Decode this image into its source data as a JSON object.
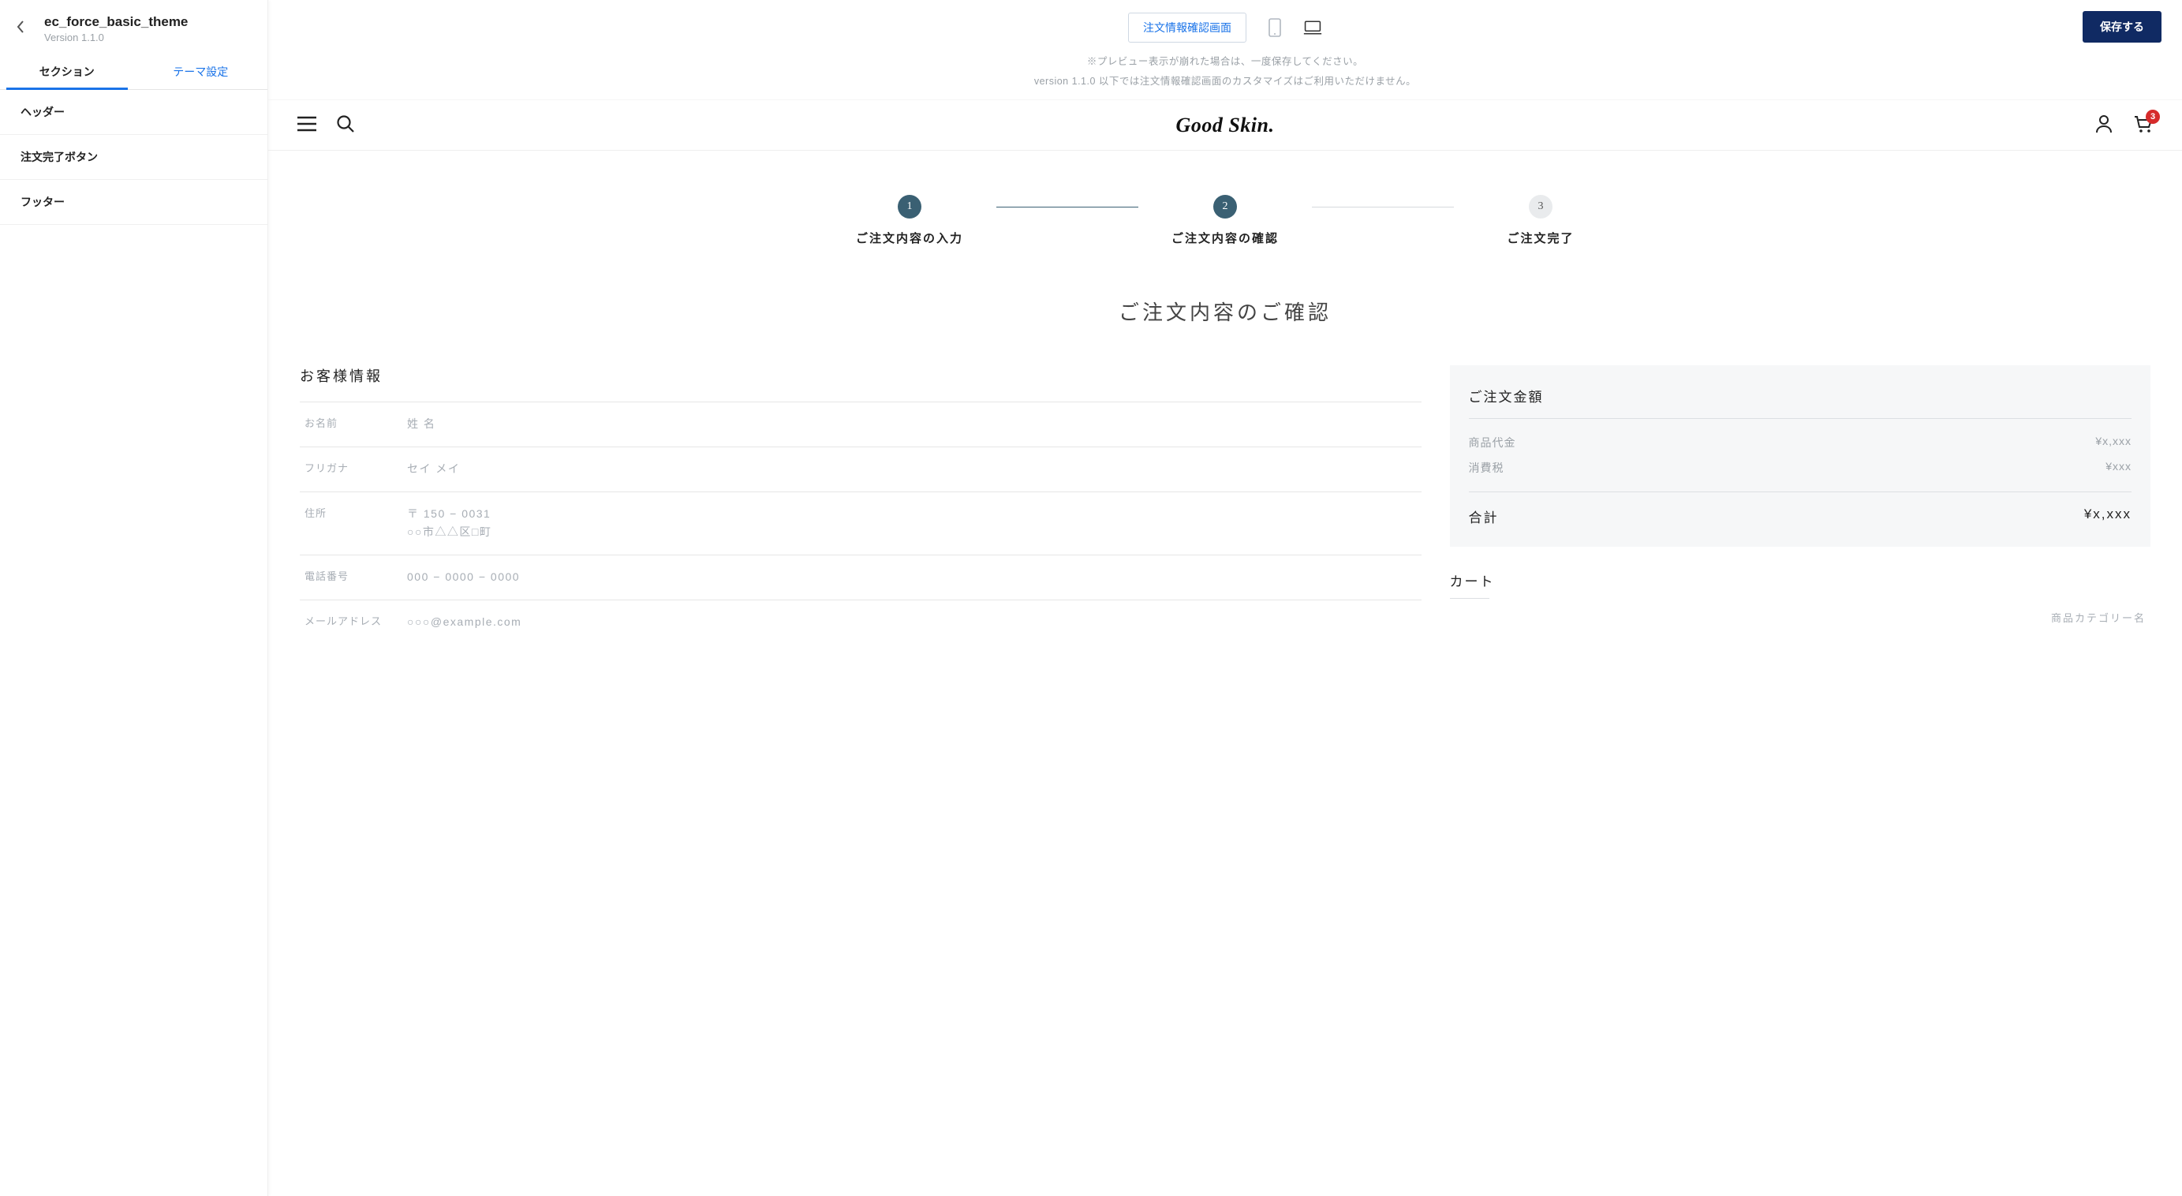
{
  "sidebar": {
    "theme_name": "ec_force_basic_theme",
    "theme_version": "Version 1.1.0",
    "tabs": {
      "sections": "セクション",
      "theme_settings": "テーマ設定"
    },
    "sections": [
      "ヘッダー",
      "注文完了ボタン",
      "フッター"
    ]
  },
  "topbar": {
    "view_label": "注文情報確認画面",
    "save_label": "保存する",
    "notice_line1": "※プレビュー表示が崩れた場合は、一度保存してください。",
    "notice_line2": "version 1.1.0 以下では注文情報確認画面のカスタマイズはご利用いただけません。"
  },
  "shop": {
    "logo_text": "Good Skin.",
    "cart_count": "3"
  },
  "steps": [
    {
      "num": "1",
      "label": "ご注文内容の入力",
      "state": "done"
    },
    {
      "num": "2",
      "label": "ご注文内容の確認",
      "state": "current"
    },
    {
      "num": "3",
      "label": "ご注文完了",
      "state": "pending"
    }
  ],
  "page_title": "ご注文内容のご確認",
  "customer_info": {
    "title": "お客様情報",
    "rows": [
      {
        "label": "お名前",
        "value": "姓 名"
      },
      {
        "label": "フリガナ",
        "value": "セイ メイ"
      },
      {
        "label": "住所",
        "value": "〒 150 − 0031\n○○市△△区□町"
      },
      {
        "label": "電話番号",
        "value": "000 − 0000 − 0000"
      },
      {
        "label": "メールアドレス",
        "value": "○○○@example.com"
      }
    ]
  },
  "summary": {
    "title": "ご注文金額",
    "rows": [
      {
        "label": "商品代金",
        "value": "¥x,xxx"
      },
      {
        "label": "消費税",
        "value": "¥xxx"
      }
    ],
    "total_label": "合計",
    "total_value": "¥x,xxx"
  },
  "cart": {
    "title": "カート",
    "category_label": "商品カテゴリー名"
  }
}
